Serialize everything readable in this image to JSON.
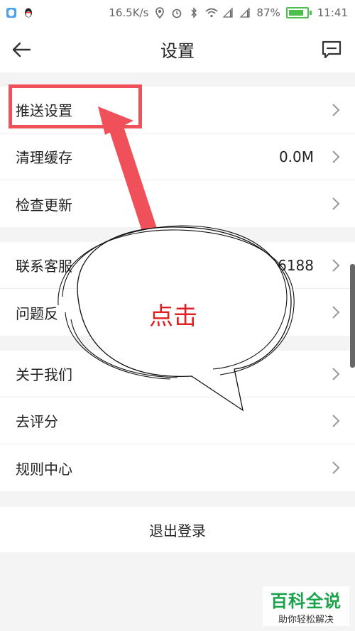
{
  "status_bar": {
    "network_speed": "16.5K/s",
    "battery_percent": "87%",
    "time": "11:41"
  },
  "header": {
    "title": "设置"
  },
  "groups": [
    {
      "items": [
        {
          "label": "推送设置",
          "value": ""
        },
        {
          "label": "清理缓存",
          "value": "0.0M"
        },
        {
          "label": "检查更新",
          "value": ""
        }
      ]
    },
    {
      "items": [
        {
          "label": "联系客服",
          "value": "106188"
        },
        {
          "label": "问题反",
          "value": ""
        }
      ]
    },
    {
      "items": [
        {
          "label": "关于我们",
          "value": ""
        },
        {
          "label": "去评分",
          "value": ""
        },
        {
          "label": "规则中心",
          "value": ""
        }
      ]
    }
  ],
  "logout": {
    "label": "退出登录"
  },
  "annotation": {
    "bubble_text": "点击"
  },
  "watermark": {
    "title": "百科全说",
    "subtitle": "助你轻松解决"
  },
  "colors": {
    "highlight": "#f0505a",
    "annotation_text": "#e02020",
    "battery": "#4cbf4c",
    "watermark_green": "#1aa34a"
  }
}
